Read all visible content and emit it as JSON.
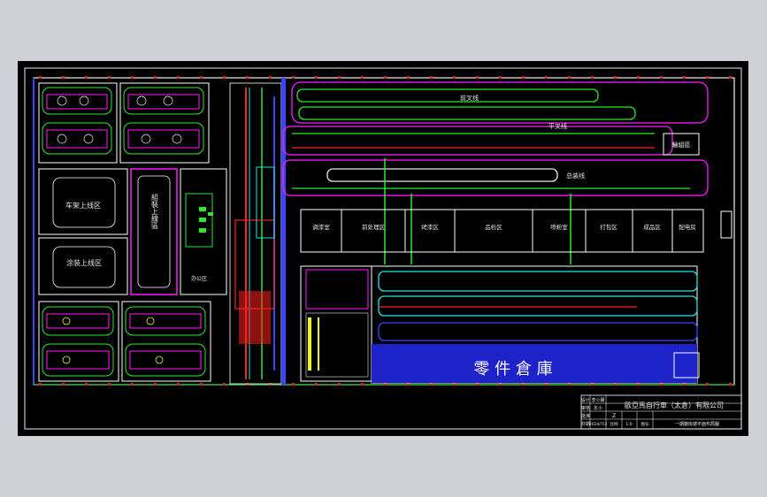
{
  "title_block": {
    "company": "歐亞馬自行車（太倉）有限公司",
    "row_labels": [
      "设计",
      "审核",
      "批准",
      "日期"
    ],
    "name_designer": "李小寶",
    "name_checker": "牟小",
    "approval_mark": "Z",
    "date": "2024/7/3",
    "scale_label": "比例",
    "scale": "1:0",
    "sheet_label": "图号",
    "drawing_name": "一期廠房總平面布局圖"
  },
  "areas": {
    "warehouse": "零 件 倉 庫",
    "frame_top": "车架上线区",
    "frame_bottom": "涂装上线区",
    "assembly_vertical": "組裝上線區",
    "office": "办公区",
    "wheel": "輪組區",
    "room_1": "调漆室",
    "room_2": "前处理区",
    "room_3": "烤漆区",
    "room_4": "品检区",
    "room_5": "喷粉室",
    "room_6": "打包区",
    "room_7": "成品区",
    "room_8": "配电房",
    "line_1": "前叉线",
    "line_2": "平叉线",
    "line_3": "总装线"
  },
  "colors": {
    "outline": "#ffffff",
    "green": "#2ee82e",
    "magenta": "#ff1cff",
    "red": "#ff2020",
    "cyan": "#22e5e5",
    "blue": "#3a44ff",
    "yellow": "#f2f22a",
    "column_marker": "#e02020",
    "background": "#000000"
  }
}
